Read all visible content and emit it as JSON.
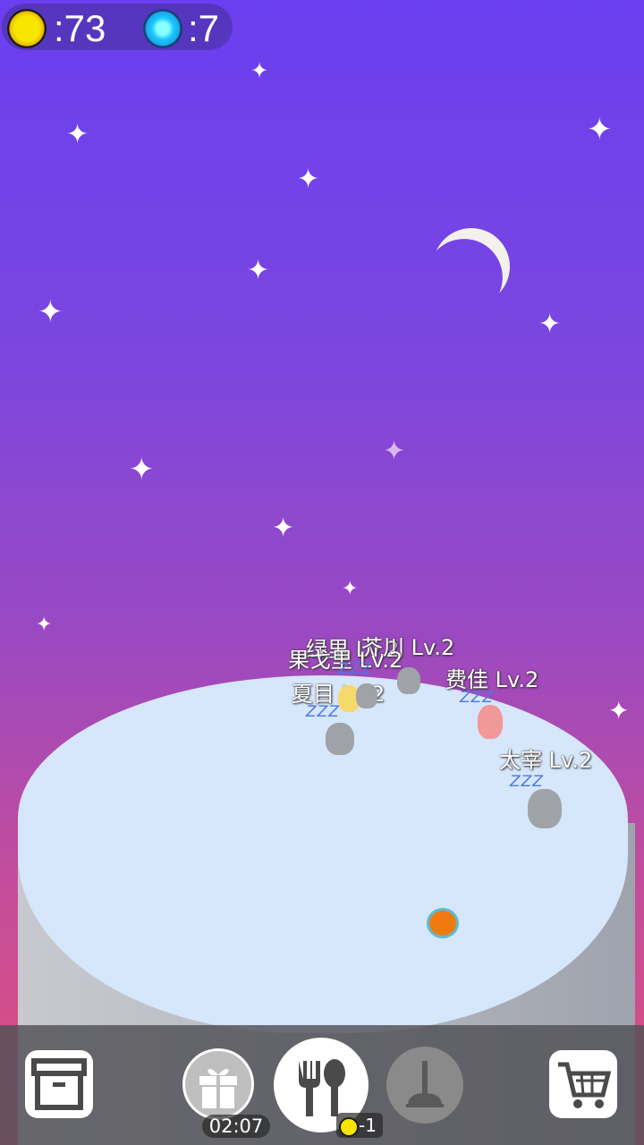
{
  "currency": {
    "coins": ":73",
    "gems": ":7"
  },
  "pets": [
    {
      "name": "绿里",
      "level": "Lv.2"
    },
    {
      "name": "芥川",
      "level": "Lv.2"
    },
    {
      "name": "果戈里",
      "level": "Lv.2"
    },
    {
      "name": "费佳",
      "level": "Lv.2"
    },
    {
      "name": "夏目",
      "level": "Lv.2"
    },
    {
      "name": "太宰",
      "level": "Lv.2"
    }
  ],
  "sleep_text": "ZZZ",
  "toolbar": {
    "gift_timer": "02:07",
    "food_cost": "-1"
  },
  "icons": [
    "coin-icon",
    "gem-icon",
    "storage-box-icon",
    "gift-icon",
    "fork-spoon-icon",
    "plunger-icon",
    "cart-icon",
    "moon-icon",
    "star-icon"
  ],
  "colors": {
    "sky_top": "#6a3ff0",
    "sky_bottom": "#e0507a",
    "island_top": "#d6e6fb",
    "zzz": "#4a78e6"
  }
}
